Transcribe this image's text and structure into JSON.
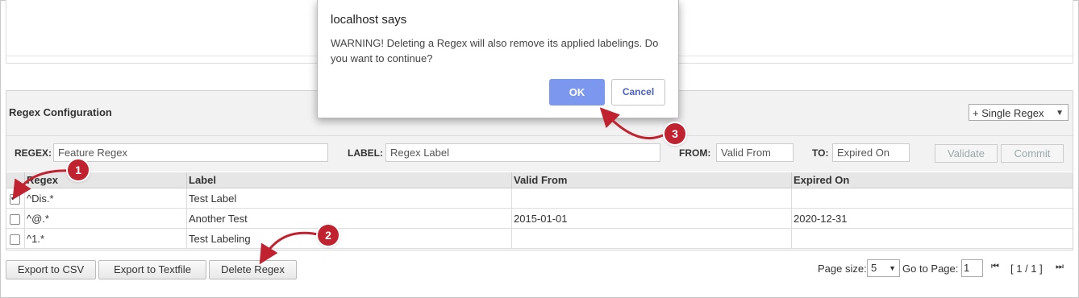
{
  "dialog": {
    "title": "localhost says",
    "message": "WARNING! Deleting a Regex will also remove its applied labelings. Do you want to continue?",
    "ok_label": "OK",
    "cancel_label": "Cancel"
  },
  "section": {
    "title": "Regex Configuration",
    "mode_select": "+ Single Regex"
  },
  "form": {
    "regex_label": "REGEX:",
    "regex_placeholder": "Feature Regex",
    "label_label": "LABEL:",
    "label_placeholder": "Regex Label",
    "from_label": "FROM:",
    "from_placeholder": "Valid From",
    "to_label": "TO:",
    "to_placeholder": "Expired On",
    "validate_label": "Validate",
    "commit_label": "Commit"
  },
  "table": {
    "columns": [
      "Regex",
      "Label",
      "Valid From",
      "Expired On"
    ],
    "rows": [
      {
        "checked": true,
        "regex": "^Dis.*",
        "label": "Test Label",
        "valid_from": "",
        "expired_on": ""
      },
      {
        "checked": false,
        "regex": "^@.*",
        "label": "Another Test",
        "valid_from": "2015-01-01",
        "expired_on": "2020-12-31"
      },
      {
        "checked": false,
        "regex": "^1.*",
        "label": "Test Labeling",
        "valid_from": "",
        "expired_on": ""
      }
    ]
  },
  "actions": {
    "export_csv": "Export to CSV",
    "export_text": "Export to Textfile",
    "delete": "Delete Regex"
  },
  "pager": {
    "page_size_label": "Page size:",
    "page_size": "5",
    "goto_label": "Go to Page:",
    "goto_value": "1",
    "page_info": "[ 1 / 1 ]"
  },
  "callouts": [
    "1",
    "2",
    "3"
  ],
  "colors": {
    "callout": "#c0222f",
    "ok_button": "#7b98ee"
  }
}
